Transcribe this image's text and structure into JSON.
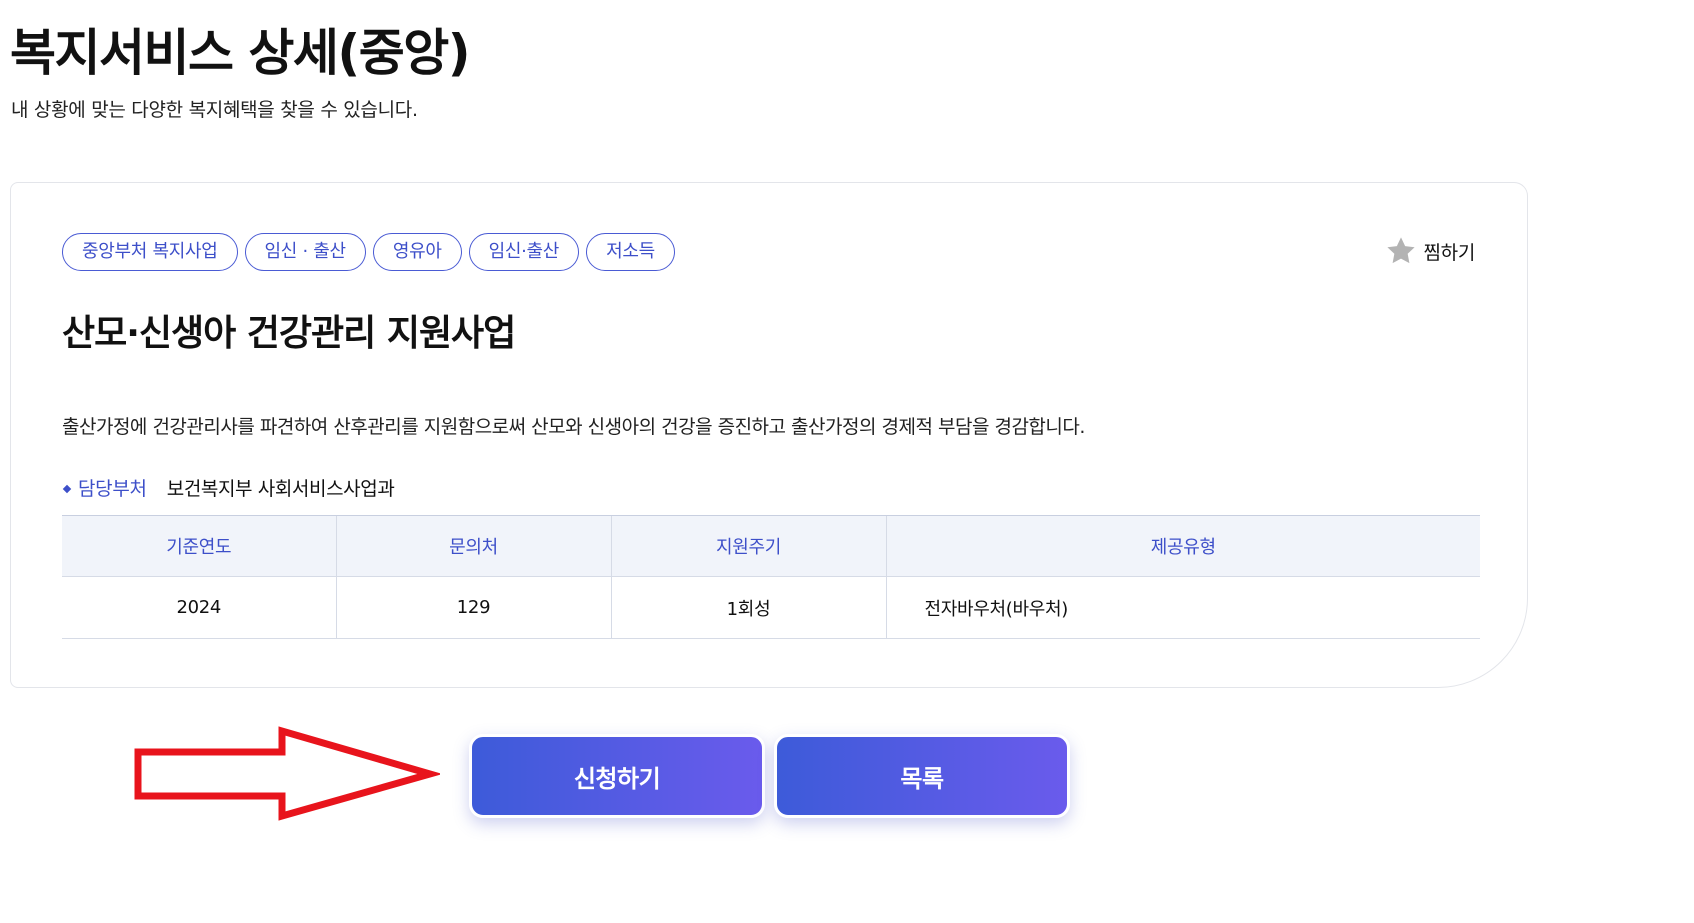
{
  "page": {
    "title": "복지서비스 상세(중앙)",
    "subtitle": "내 상황에 맞는 다양한 복지혜택을 찾을 수 있습니다."
  },
  "service": {
    "tags": [
      "중앙부처 복지사업",
      "임신 · 출산",
      "영유아",
      "임신·출산",
      "저소득"
    ],
    "bookmark_label": "찜하기",
    "title": "산모·신생아 건강관리 지원사업",
    "description": "출산가정에 건강관리사를 파견하여 산후관리를 지원함으로써 산모와 신생아의 건강을 증진하고 출산가정의 경제적 부담을 경감합니다.",
    "department": {
      "label": "담당부처",
      "value": "보건복지부 사회서비스사업과"
    },
    "table": {
      "headers": [
        "기준연도",
        "문의처",
        "지원주기",
        "제공유형"
      ],
      "row": [
        "2024",
        "129",
        "1회성",
        "전자바우처(바우처)"
      ]
    }
  },
  "actions": {
    "apply_label": "신청하기",
    "list_label": "목록"
  },
  "annotation": {
    "arrow_color": "#e8141c"
  },
  "colors": {
    "accent": "#3d4fc9",
    "button_gradient_start": "#3d5bd9",
    "button_gradient_end": "#6a5bec",
    "table_header_bg": "#f1f4fa"
  },
  "icons": {
    "bookmark": "star-icon",
    "department_bullet": "diamond-bullet-icon",
    "annotation": "red-arrow-outline"
  }
}
